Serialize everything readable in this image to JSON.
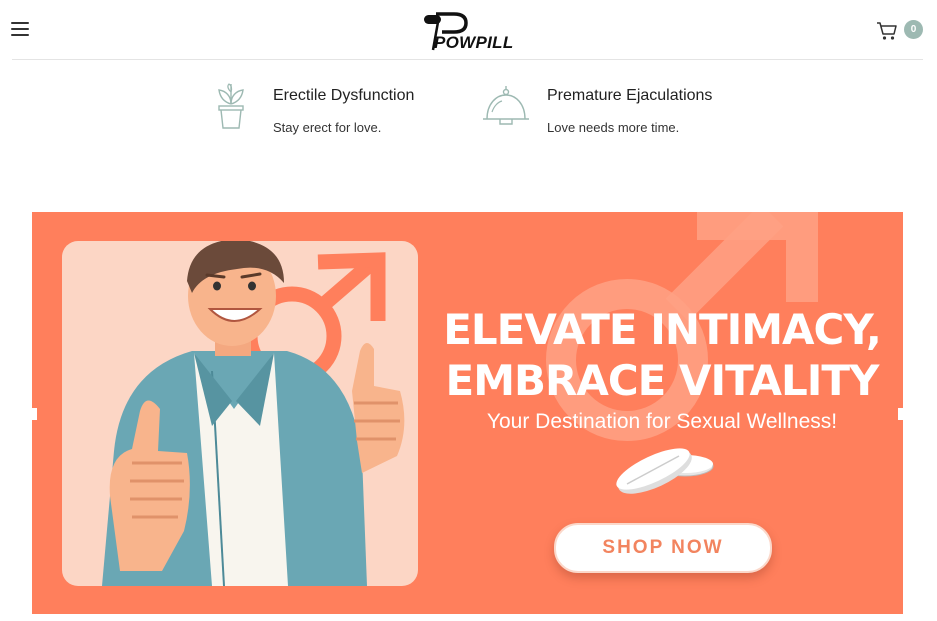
{
  "header": {
    "brand": "POWPILL",
    "cart_count": "0"
  },
  "features": [
    {
      "title": "Erectile Dysfunction",
      "description": "Stay erect for love."
    },
    {
      "title": "Premature Ejaculations",
      "description": "Love needs more time."
    }
  ],
  "banner": {
    "headline_line1": "ELEVATE INTIMACY,",
    "headline_line2": "EMBRACE VITALITY",
    "tagline": "Your Destination for Sexual Wellness!",
    "cta_label": "SHOP NOW"
  },
  "colors": {
    "banner_bg": "#ff7f5c",
    "illustration_bg": "#fcd6c5",
    "accent_teal": "#9db9b2",
    "cta_text": "#f2845f"
  }
}
